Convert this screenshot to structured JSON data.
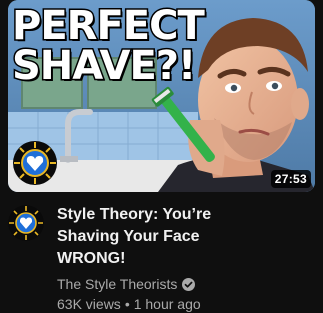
{
  "thumbnail": {
    "overlay_text": "PERFECT\nSHAVE?!",
    "duration": "27:53",
    "badge_icon": "heart-crest-icon"
  },
  "video": {
    "title": "Style Theory: You’re Shaving Your Face WRONG!",
    "channel": "The Style Theorists",
    "verified_icon": "verified-check-icon",
    "views": "63K views",
    "separator": "•",
    "age": "1 hour ago"
  },
  "colors": {
    "background": "#0f0f0f",
    "title_text": "#f1f1f1",
    "secondary_text": "#aaaaaa",
    "razor_green": "#33b24a",
    "crest_blue": "#1e6fd9",
    "crest_gold": "#e9b825"
  }
}
